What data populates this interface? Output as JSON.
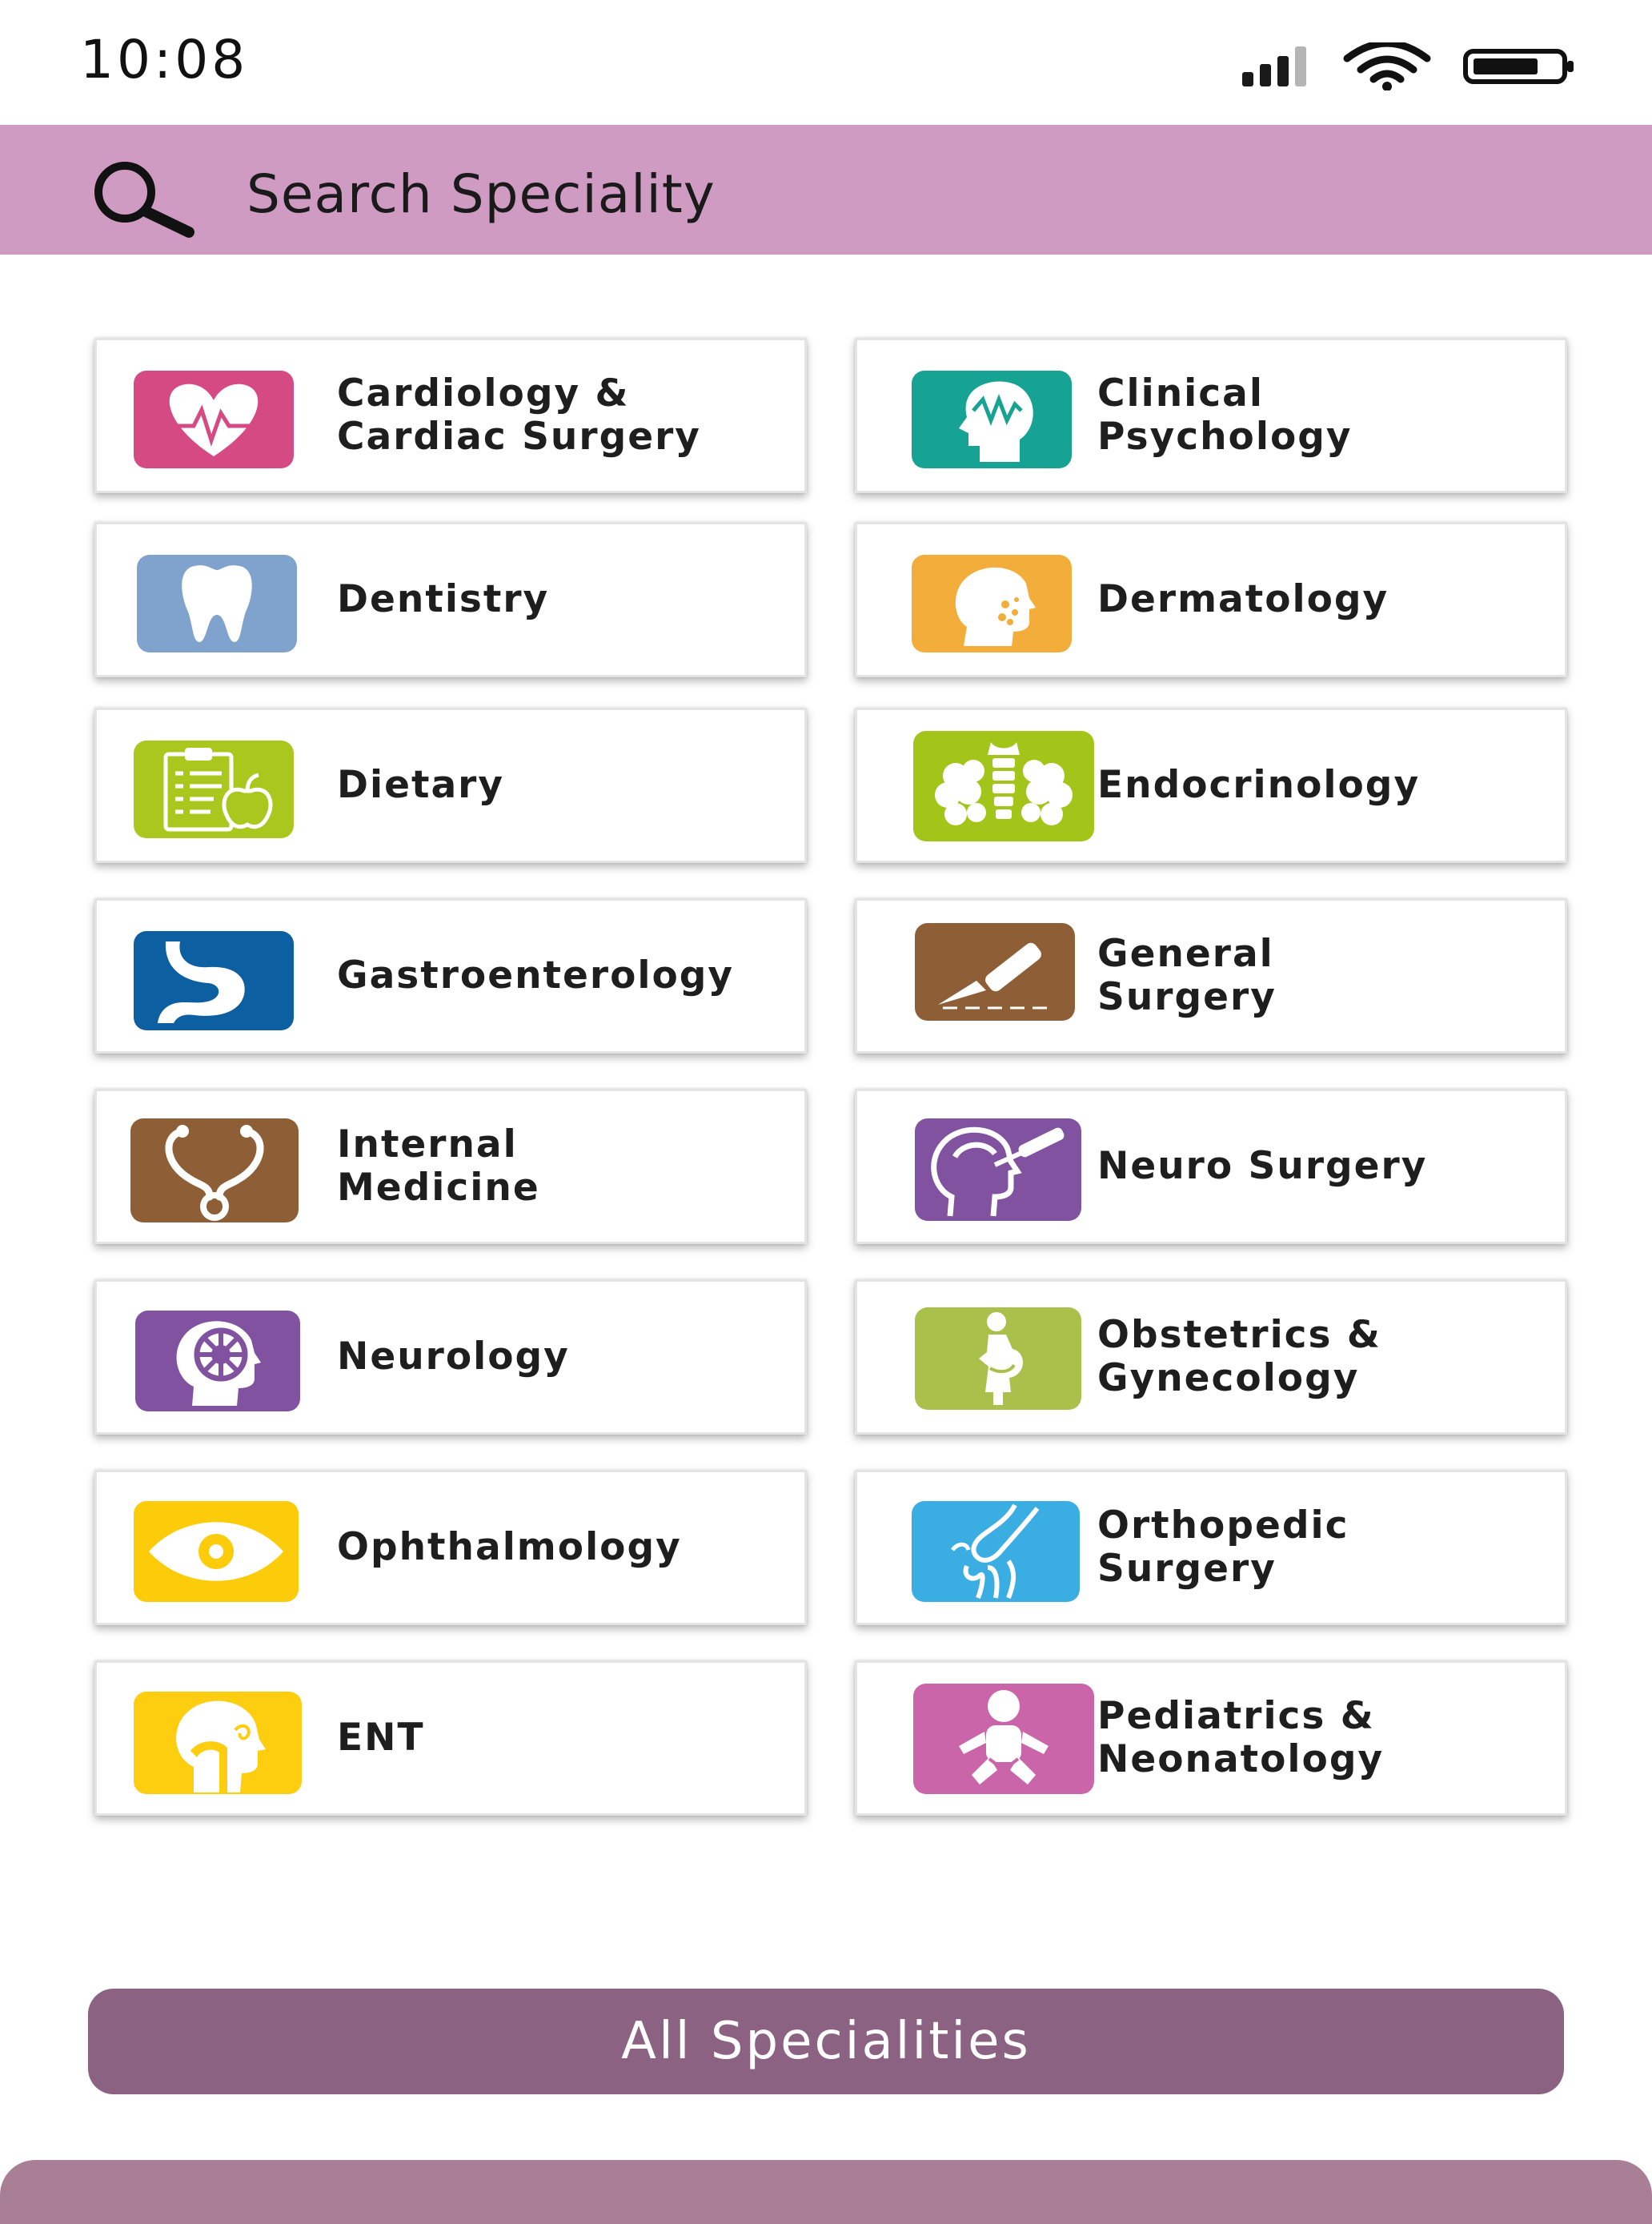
{
  "status_bar": {
    "time": "10:08"
  },
  "search": {
    "placeholder": "Search Speciality",
    "bar_color": "#cf9bc3"
  },
  "specialities": [
    {
      "label": "Cardiology &\nCardiac Surgery",
      "icon": "heart-pulse-icon",
      "color": "#d64a84"
    },
    {
      "label": "Clinical\nPsychology",
      "icon": "head-wave-icon",
      "color": "#17a393"
    },
    {
      "label": "Dentistry",
      "icon": "tooth-icon",
      "color": "#7fa3cd"
    },
    {
      "label": "Dermatology",
      "icon": "face-spots-icon",
      "color": "#f3ad3a"
    },
    {
      "label": "Dietary",
      "icon": "clipboard-apple-icon",
      "color": "#a9c71c"
    },
    {
      "label": "Endocrinology",
      "icon": "thyroid-glands-icon",
      "color": "#a3c51a"
    },
    {
      "label": "Gastroenterology",
      "icon": "stomach-icon",
      "color": "#0c5fa0"
    },
    {
      "label": "General\nSurgery",
      "icon": "scalpel-icon",
      "color": "#8e5f37"
    },
    {
      "label": "Internal\nMedicine",
      "icon": "stethoscope-icon",
      "color": "#8e5f37"
    },
    {
      "label": "Neuro Surgery",
      "icon": "head-scalpel-icon",
      "color": "#8052a0"
    },
    {
      "label": "Neurology",
      "icon": "brain-head-icon",
      "color": "#8052a0"
    },
    {
      "label": "Obstetrics &\nGynecology",
      "icon": "pregnant-woman-icon",
      "color": "#a9c14a"
    },
    {
      "label": "Ophthalmology",
      "icon": "eye-icon",
      "color": "#fccc0a"
    },
    {
      "label": "Orthopedic\nSurgery",
      "icon": "knee-joint-icon",
      "color": "#3aade2"
    },
    {
      "label": "ENT",
      "icon": "head-throat-icon",
      "color": "#fdcd0f"
    },
    {
      "label": "Pediatrics &\nNeonatology",
      "icon": "baby-icon",
      "color": "#c965a8"
    }
  ],
  "all_button": {
    "label": "All Specialities",
    "color": "#8b6282"
  },
  "bottom_bar": {
    "color": "#a87f94"
  }
}
